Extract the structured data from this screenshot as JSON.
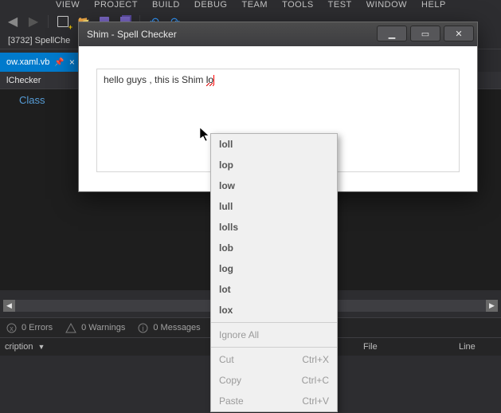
{
  "ide_menu": [
    "VIEW",
    "PROJECT",
    "BUILD",
    "DEBUG",
    "TEAM",
    "TOOLS",
    "TEST",
    "WINDOW",
    "HELP"
  ],
  "process_bar": "[3732] SpellChe",
  "doc_tab": {
    "label": "ow.xaml.vb",
    "pin": "📌",
    "close": "×"
  },
  "crumbs": [
    "lChecker",
    "Class"
  ],
  "hscroll": {
    "left": "◀",
    "right": "▶"
  },
  "errbar": {
    "errors": "0 Errors",
    "warnings": "0 Warnings",
    "messages": "0 Messages"
  },
  "errcols": {
    "description": "cription",
    "file": "File",
    "line": "Line"
  },
  "win": {
    "title": "Shim - Spell Checker",
    "text_prefix": "hello guys , this is Shim ",
    "text_miss": "lo"
  },
  "ctx": {
    "suggestions": [
      "loll",
      "lop",
      "low",
      "lull",
      "lolls",
      "lob",
      "log",
      "lot",
      "lox"
    ],
    "ignore": "Ignore All",
    "edit": [
      {
        "label": "Cut",
        "shortcut": "Ctrl+X"
      },
      {
        "label": "Copy",
        "shortcut": "Ctrl+C"
      },
      {
        "label": "Paste",
        "shortcut": "Ctrl+V"
      }
    ]
  }
}
